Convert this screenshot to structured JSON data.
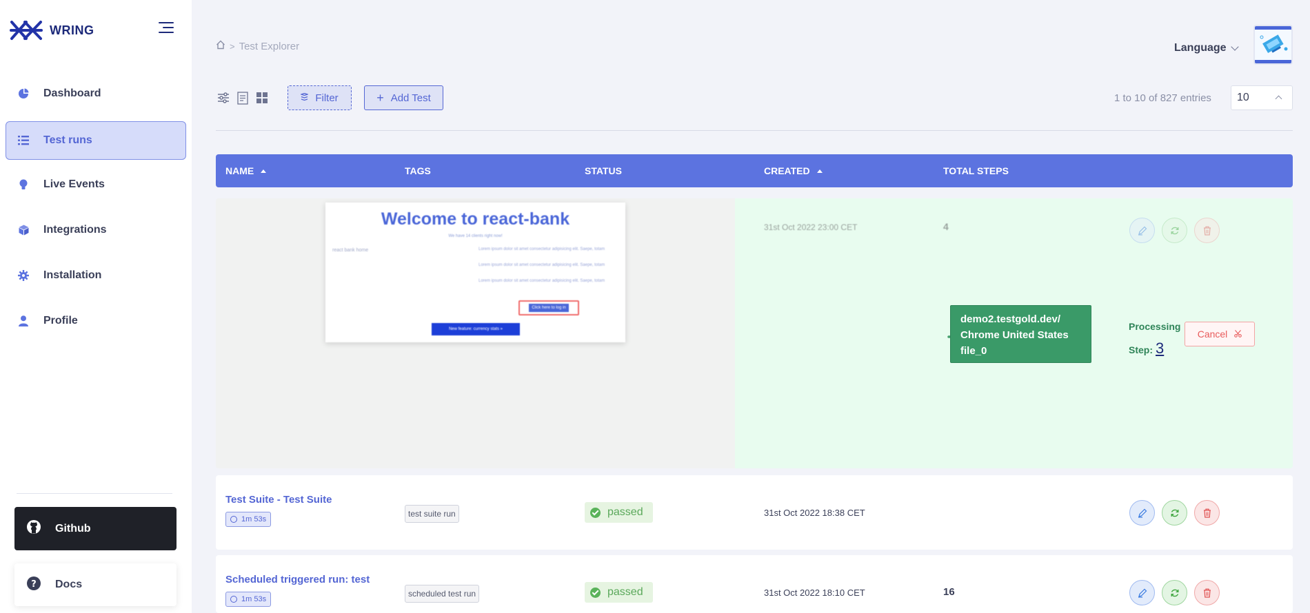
{
  "app": {
    "name": "WRING"
  },
  "sidebar": {
    "items": [
      {
        "label": "Dashboard",
        "icon": "pie-chart-icon"
      },
      {
        "label": "Test runs",
        "icon": "list-icon",
        "active": true
      },
      {
        "label": "Live Events",
        "icon": "bulb-icon"
      },
      {
        "label": "Integrations",
        "icon": "cube-icon"
      },
      {
        "label": "Installation",
        "icon": "gear-icon"
      },
      {
        "label": "Profile",
        "icon": "user-icon"
      }
    ],
    "github_label": "Github",
    "docs_label": "Docs"
  },
  "header": {
    "breadcrumb": "Test Explorer",
    "language_label": "Language"
  },
  "toolbar": {
    "filter_label": "Filter",
    "add_test_label": "Add Test",
    "entries_text": "1 to 10 of 827 entries",
    "page_size": "10"
  },
  "table": {
    "columns": [
      "NAME",
      "TAGS",
      "STATUS",
      "CREATED",
      "TOTAL STEPS"
    ],
    "processing_row": {
      "created": "31st Oct 2022 23:00 CET",
      "total_steps": "4",
      "preview": {
        "title": "Welcome to react-bank",
        "subtitle": "We have 14 clients right now!",
        "alt_text": "react bank home",
        "lorem_1": "Lorem ipsum dolor sit amet consectetur adipisicing elit. Saepe, totam",
        "lorem_2": "Lorem ipsum dolor sit amet consectetur adipisicing elit. Saepe, totam",
        "lorem_3": "Lorem ipsum dolor sit amet consectetur adipisicing elit. Saepe, totam",
        "login_button": "Click here to log in",
        "feature_button": "New feature: currency stats »"
      },
      "run_line_1": "demo2.testgold.dev/",
      "run_line_2": "Chrome United States",
      "run_line_3": "file_0",
      "processing_label": "Processing",
      "step_label": "Step:",
      "step_number": "3",
      "cancel_label": "Cancel"
    },
    "rows": [
      {
        "name": "Test Suite - Test Suite",
        "duration": "1m 53s",
        "tag": "test suite run",
        "status": "passed",
        "created": "31st Oct 2022 18:38 CET",
        "total_steps": ""
      },
      {
        "name": "Scheduled triggered run: test",
        "duration": "1m 53s",
        "tag": "scheduled test run",
        "status": "passed",
        "created": "31st Oct 2022 18:10 CET",
        "total_steps": "16"
      }
    ]
  },
  "colors": {
    "accent": "#5c73e0",
    "brand_dark": "#1d2a7a",
    "processing_bg": "#e8fcef",
    "run_box": "#3a9a68",
    "passed": "#5aa85a"
  }
}
